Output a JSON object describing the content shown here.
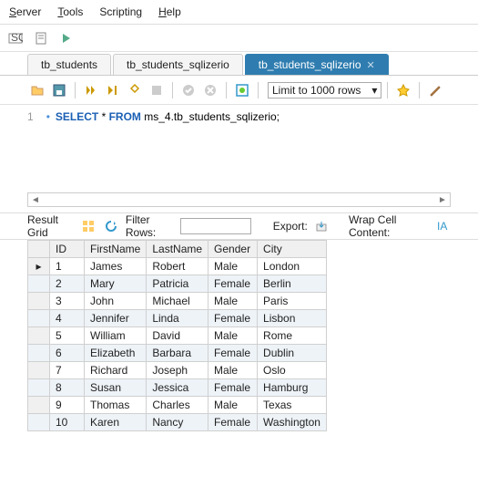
{
  "menu": {
    "items": [
      "Server",
      "Tools",
      "Scripting",
      "Help"
    ]
  },
  "tabs": [
    {
      "label": "tb_students",
      "active": false
    },
    {
      "label": "tb_students_sqlizerio",
      "active": false
    },
    {
      "label": "tb_students_sqlizerio",
      "active": true
    }
  ],
  "editor": {
    "line_number": "1",
    "limit_label": "Limit to 1000 rows",
    "sql_kw1": "SELECT",
    "sql_star": " * ",
    "sql_kw2": "FROM",
    "sql_rest": " ms_4.tb_students_sqlizerio;"
  },
  "result_bar": {
    "grid_label": "Result Grid",
    "filter_label": "Filter Rows:",
    "export_label": "Export:",
    "wrap_label": "Wrap Cell Content:"
  },
  "columns": [
    "ID",
    "FirstName",
    "LastName",
    "Gender",
    "City"
  ],
  "rows": [
    {
      "id": "1",
      "first": "James",
      "last": "Robert",
      "gender": "Male",
      "city": "London"
    },
    {
      "id": "2",
      "first": "Mary",
      "last": "Patricia",
      "gender": "Female",
      "city": "Berlin"
    },
    {
      "id": "3",
      "first": "John",
      "last": "Michael",
      "gender": "Male",
      "city": "Paris"
    },
    {
      "id": "4",
      "first": "Jennifer",
      "last": "Linda",
      "gender": "Female",
      "city": "Lisbon"
    },
    {
      "id": "5",
      "first": "William",
      "last": "David",
      "gender": "Male",
      "city": "Rome"
    },
    {
      "id": "6",
      "first": "Elizabeth",
      "last": "Barbara",
      "gender": "Female",
      "city": "Dublin"
    },
    {
      "id": "7",
      "first": "Richard",
      "last": "Joseph",
      "gender": "Male",
      "city": "Oslo"
    },
    {
      "id": "8",
      "first": "Susan",
      "last": "Jessica",
      "gender": "Female",
      "city": "Hamburg"
    },
    {
      "id": "9",
      "first": "Thomas",
      "last": "Charles",
      "gender": "Male",
      "city": "Texas"
    },
    {
      "id": "10",
      "first": "Karen",
      "last": "Nancy",
      "gender": "Female",
      "city": "Washington"
    }
  ]
}
